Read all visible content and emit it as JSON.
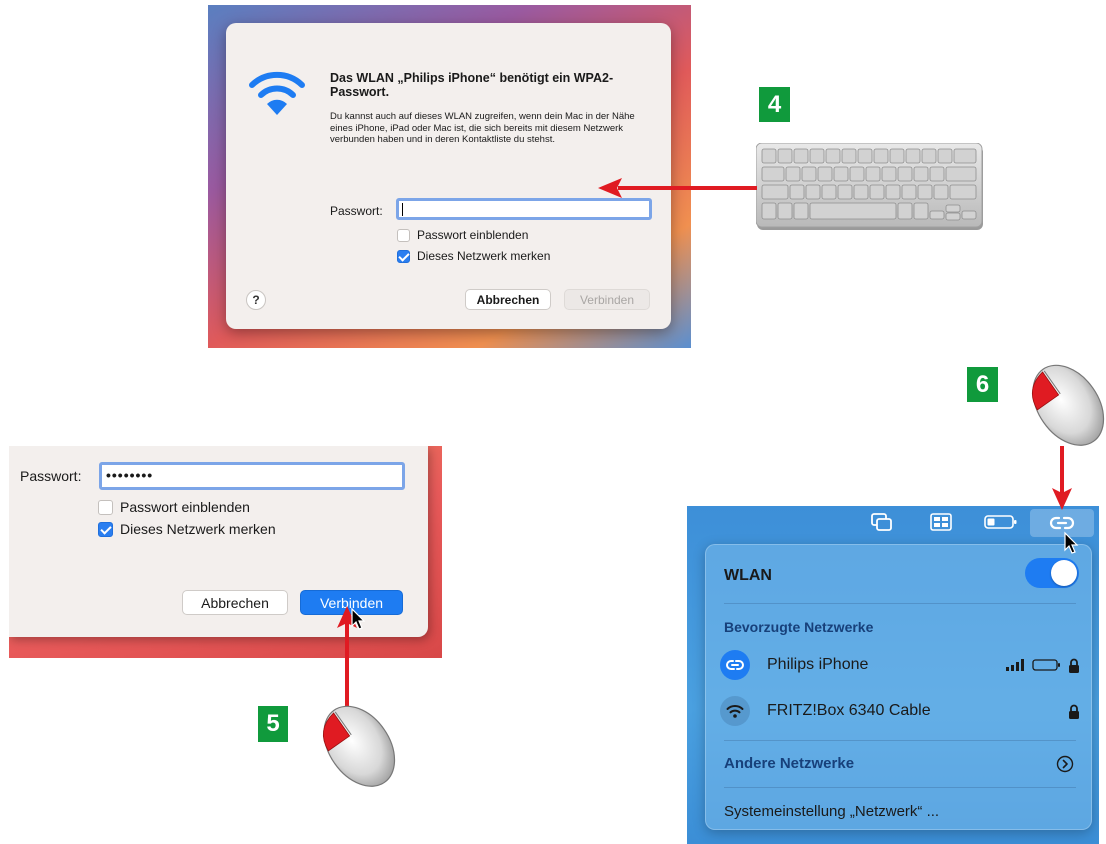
{
  "colors": {
    "accent_blue": "#1e7cf2",
    "step_green": "#109a3c",
    "arrow_red": "#e01b22"
  },
  "steps": {
    "step4": "4",
    "step5": "5",
    "step6": "6"
  },
  "dialog1": {
    "title": "Das WLAN „Philips iPhone“ benötigt ein WPA2-Passwort.",
    "body": "Du kannst auch auf dieses WLAN zugreifen, wenn dein Mac in der Nähe eines iPhone, iPad oder Mac ist, die sich bereits mit diesem Netzwerk verbunden haben und in deren Kontaktliste du stehst.",
    "password_label": "Passwort:",
    "password_value": "",
    "show_password_label": "Passwort einblenden",
    "show_password_checked": false,
    "remember_label": "Dieses Netzwerk merken",
    "remember_checked": true,
    "help": "?",
    "cancel": "Abbrechen",
    "connect": "Verbinden",
    "icon": "wifi-icon"
  },
  "dialog2": {
    "password_label": "Passwort:",
    "password_value": "••••••••",
    "show_password_label": "Passwort einblenden",
    "show_password_checked": false,
    "remember_label": "Dieses Netzwerk merken",
    "remember_checked": true,
    "cancel": "Abbrechen",
    "connect": "Verbinden"
  },
  "menubar": {
    "icons": [
      "screen-mirroring-icon",
      "control-center-icon",
      "battery-icon",
      "personal-hotspot-icon"
    ]
  },
  "wlan_menu": {
    "title": "WLAN",
    "wlan_on": true,
    "preferred_header": "Bevorzugte Netzwerke",
    "networks": [
      {
        "name": "Philips iPhone",
        "icon": "hotspot-link-icon",
        "signal": "signal-bars-icon",
        "battery": "battery-icon",
        "locked": true
      },
      {
        "name": "FRITZ!Box 6340 Cable",
        "icon": "wifi-icon",
        "locked": true
      }
    ],
    "other_networks": "Andere Netzwerke",
    "settings": "Systemeinstellung „Netzwerk“ ..."
  }
}
